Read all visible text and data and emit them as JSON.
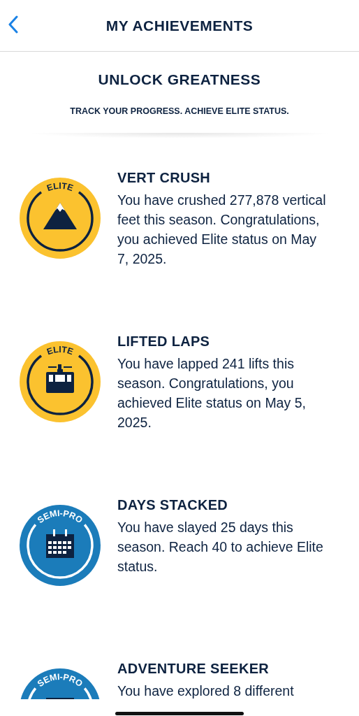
{
  "header": {
    "title": "MY ACHIEVEMENTS"
  },
  "hero": {
    "title": "UNLOCK GREATNESS",
    "subtitle": "TRACK YOUR PROGRESS. ACHIEVE ELITE STATUS."
  },
  "achievements": [
    {
      "kind": "mountain",
      "tier": "ELITE",
      "color": "#fbc22f",
      "title": "VERT CRUSH",
      "text": "You have crushed 277,878 vertical feet this season. Congratulations, you achieved Elite status on May 7, 2025."
    },
    {
      "kind": "gondola",
      "tier": "ELITE",
      "color": "#fbc22f",
      "title": "LIFTED LAPS",
      "text": "You have lapped 241 lifts this season. Congratulations, you achieved Elite status on May 5, 2025."
    },
    {
      "kind": "calendar",
      "tier": "SEMI-PRO",
      "color": "#1b7cba",
      "title": "DAYS STACKED",
      "text": "You have slayed 25 days this season. Reach 40 to achieve Elite status."
    },
    {
      "kind": "frame",
      "tier": "SEMI-PRO",
      "color": "#1b7cba",
      "title": "ADVENTURE SEEKER",
      "text": "You have explored 8 different"
    }
  ]
}
